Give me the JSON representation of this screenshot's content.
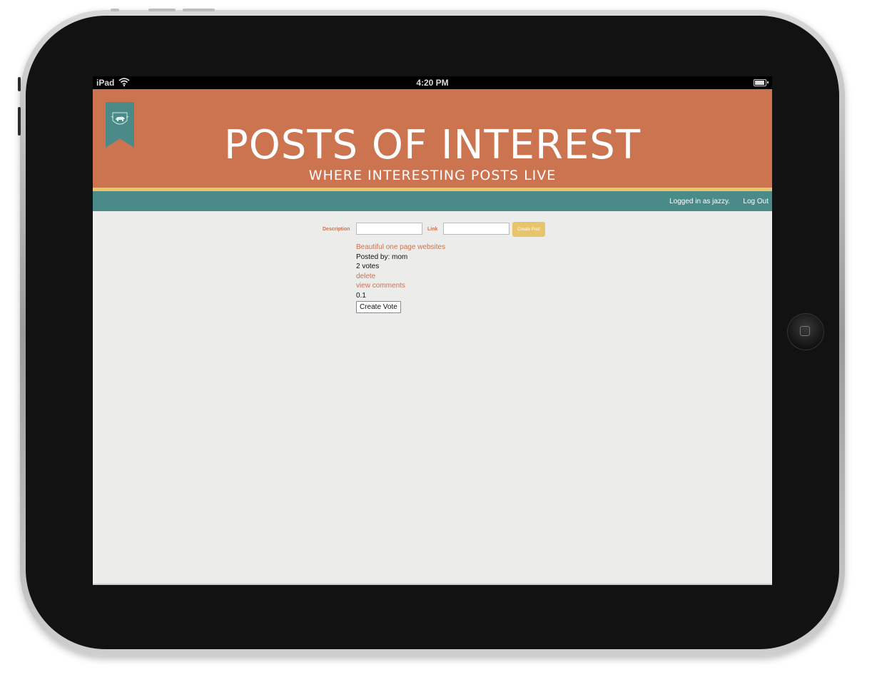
{
  "statusbar": {
    "device_name": "iPad",
    "time": "4:20 PM"
  },
  "header": {
    "title": "POSTS OF INTEREST",
    "subtitle": "WHERE INTERESTING POSTS LIVE"
  },
  "nav": {
    "logged_in_text": "Logged in as jazzy.",
    "logout_label": "Log Out"
  },
  "form": {
    "description_label": "Description",
    "description_value": "",
    "link_label": "Link",
    "link_value": "",
    "submit_label": "Create Post"
  },
  "post": {
    "title": "Beautiful one page websites",
    "posted_by": "Posted by: mom",
    "votes": "2 votes",
    "delete_label": "delete",
    "comments_label": "view comments",
    "score": "0.1",
    "vote_button_label": "Create Vote"
  },
  "colors": {
    "banner": "#cc7350",
    "stripe": "#e8c56a",
    "nav": "#4a8a89",
    "link": "#cc7350",
    "page_bg": "#ececea"
  },
  "icons": [
    "wifi-icon",
    "battery-icon",
    "bear-crest-icon",
    "home-button-icon"
  ]
}
